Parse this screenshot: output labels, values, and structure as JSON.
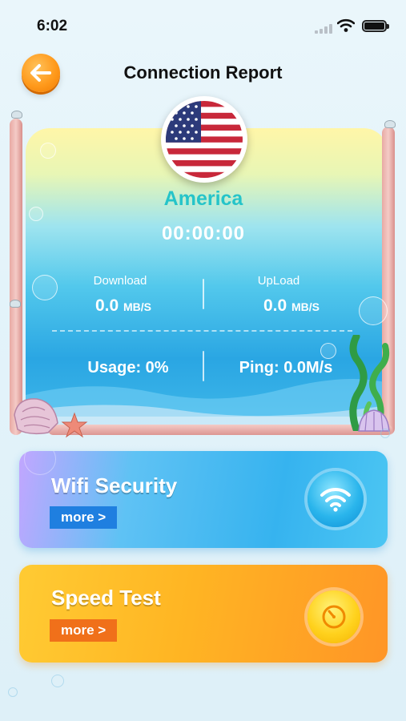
{
  "status_bar": {
    "time": "6:02"
  },
  "header": {
    "title": "Connection Report",
    "back_icon": "arrow-left-icon"
  },
  "report": {
    "flag_icon": "us-flag-icon",
    "country": "America",
    "timer": "00:00:00",
    "download": {
      "label": "Download",
      "value": "0.0",
      "unit": "MB/S"
    },
    "upload": {
      "label": "UpLoad",
      "value": "0.0",
      "unit": "MB/S"
    },
    "usage": "Usage: 0%",
    "ping": "Ping: 0.0M/s"
  },
  "features": {
    "wifi_security": {
      "title": "Wifi Security",
      "more": "more >",
      "icon": "wifi-icon"
    },
    "speed_test": {
      "title": "Speed Test",
      "more": "more >",
      "icon": "speedometer-icon"
    }
  },
  "colors": {
    "accent_teal": "#25c4c9",
    "wifi_blue": "#36b3ef",
    "speed_orange": "#ffb523",
    "back_orange": "#ff9a1c"
  }
}
